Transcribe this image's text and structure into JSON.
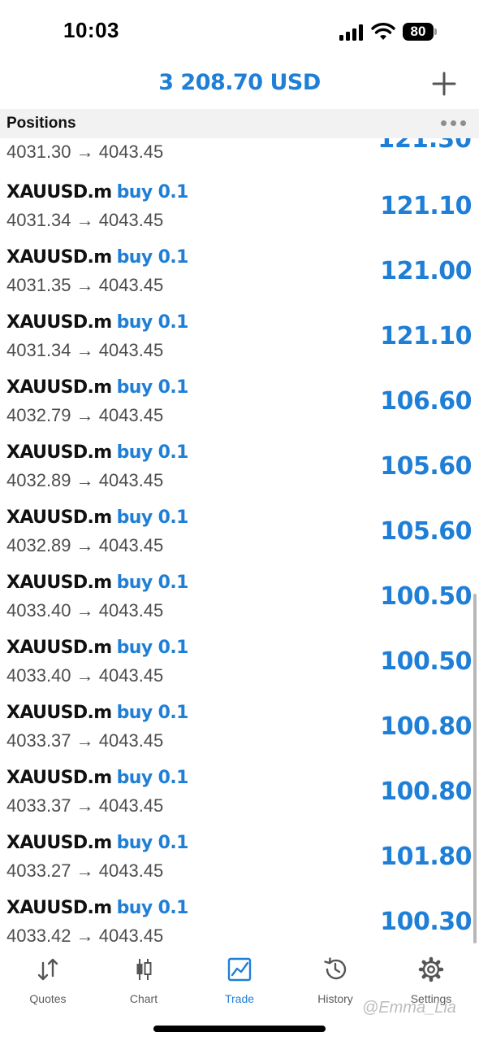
{
  "status_bar": {
    "time": "10:03",
    "battery": "80"
  },
  "header": {
    "balance": "3 208.70 USD"
  },
  "positions": {
    "title": "Positions",
    "partial_row": {
      "prices": "4031.30 → 4043.45",
      "profit": "121.30"
    },
    "rows": [
      {
        "symbol": "XAUUSD.m",
        "side": "buy 0.1",
        "prices": "4031.34 → 4043.45",
        "profit": "121.10"
      },
      {
        "symbol": "XAUUSD.m",
        "side": "buy 0.1",
        "prices": "4031.35 → 4043.45",
        "profit": "121.00"
      },
      {
        "symbol": "XAUUSD.m",
        "side": "buy 0.1",
        "prices": "4031.34 → 4043.45",
        "profit": "121.10"
      },
      {
        "symbol": "XAUUSD.m",
        "side": "buy 0.1",
        "prices": "4032.79 → 4043.45",
        "profit": "106.60"
      },
      {
        "symbol": "XAUUSD.m",
        "side": "buy 0.1",
        "prices": "4032.89 → 4043.45",
        "profit": "105.60"
      },
      {
        "symbol": "XAUUSD.m",
        "side": "buy 0.1",
        "prices": "4032.89 → 4043.45",
        "profit": "105.60"
      },
      {
        "symbol": "XAUUSD.m",
        "side": "buy 0.1",
        "prices": "4033.40 → 4043.45",
        "profit": "100.50"
      },
      {
        "symbol": "XAUUSD.m",
        "side": "buy 0.1",
        "prices": "4033.40 → 4043.45",
        "profit": "100.50"
      },
      {
        "symbol": "XAUUSD.m",
        "side": "buy 0.1",
        "prices": "4033.37 → 4043.45",
        "profit": "100.80"
      },
      {
        "symbol": "XAUUSD.m",
        "side": "buy 0.1",
        "prices": "4033.37 → 4043.45",
        "profit": "100.80"
      },
      {
        "symbol": "XAUUSD.m",
        "side": "buy 0.1",
        "prices": "4033.27 → 4043.45",
        "profit": "101.80"
      },
      {
        "symbol": "XAUUSD.m",
        "side": "buy 0.1",
        "prices": "4033.42 → 4043.45",
        "profit": "100.30"
      }
    ]
  },
  "tabs": [
    {
      "label": "Quotes",
      "icon": "quotes-icon"
    },
    {
      "label": "Chart",
      "icon": "chart-icon"
    },
    {
      "label": "Trade",
      "icon": "trade-icon",
      "active": true
    },
    {
      "label": "History",
      "icon": "history-icon"
    },
    {
      "label": "Settings",
      "icon": "settings-icon"
    }
  ],
  "watermark": "@Emma_Lia",
  "colors": {
    "accent": "#1f7fd6",
    "text": "#111111",
    "secondary": "#4d4d4d",
    "bar": "#f2f2f2"
  }
}
